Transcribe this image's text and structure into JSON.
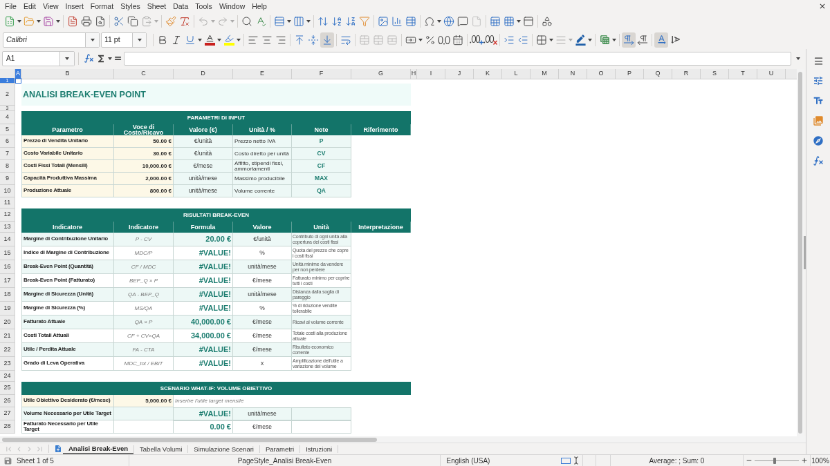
{
  "menu_bar": [
    "File",
    "Edit",
    "View",
    "Insert",
    "Format",
    "Styles",
    "Sheet",
    "Data",
    "Tools",
    "Window",
    "Help"
  ],
  "standard_toolbar": {
    "groups": [
      [
        {
          "kind": "new-spreadsheet",
          "dropdown": true,
          "disabled": false,
          "pressed": false
        },
        {
          "kind": "open",
          "dropdown": true,
          "disabled": false,
          "pressed": false
        },
        {
          "kind": "save",
          "dropdown": true,
          "disabled": false,
          "pressed": false
        }
      ],
      [
        {
          "kind": "export-pdf",
          "dropdown": false,
          "disabled": false,
          "pressed": false
        },
        {
          "kind": "print",
          "dropdown": false,
          "disabled": false,
          "pressed": false
        },
        {
          "kind": "print-preview",
          "dropdown": false,
          "disabled": false,
          "pressed": false
        }
      ],
      [
        {
          "kind": "cut",
          "dropdown": false,
          "disabled": false,
          "pressed": false
        },
        {
          "kind": "copy",
          "dropdown": false,
          "disabled": false,
          "pressed": false
        },
        {
          "kind": "paste",
          "dropdown": true,
          "disabled": true,
          "pressed": false
        }
      ],
      [
        {
          "kind": "clone-formatting",
          "dropdown": false,
          "disabled": false,
          "pressed": false
        },
        {
          "kind": "clear-formatting",
          "dropdown": false,
          "disabled": false,
          "pressed": false
        }
      ],
      [
        {
          "kind": "undo",
          "dropdown": true,
          "disabled": true,
          "pressed": false
        },
        {
          "kind": "redo",
          "dropdown": true,
          "disabled": true,
          "pressed": false
        }
      ],
      [
        {
          "kind": "find-replace",
          "dropdown": false,
          "disabled": false,
          "pressed": false
        },
        {
          "kind": "spelling",
          "dropdown": false,
          "disabled": false,
          "pressed": false
        }
      ],
      [
        {
          "kind": "row",
          "dropdown": true,
          "disabled": false,
          "pressed": false
        },
        {
          "kind": "column",
          "dropdown": true,
          "disabled": false,
          "pressed": false
        }
      ],
      [
        {
          "kind": "sort",
          "dropdown": false,
          "disabled": false,
          "pressed": false
        },
        {
          "kind": "sort-ascending",
          "dropdown": false,
          "disabled": false,
          "pressed": false
        },
        {
          "kind": "sort-descending",
          "dropdown": false,
          "disabled": false,
          "pressed": false
        },
        {
          "kind": "autofilter",
          "dropdown": false,
          "disabled": false,
          "pressed": false
        }
      ],
      [
        {
          "kind": "image",
          "dropdown": false,
          "disabled": false,
          "pressed": false
        },
        {
          "kind": "chart",
          "dropdown": false,
          "disabled": false,
          "pressed": false
        },
        {
          "kind": "pivot-table",
          "dropdown": false,
          "disabled": false,
          "pressed": false
        }
      ],
      [
        {
          "kind": "special-character",
          "dropdown": true,
          "disabled": false,
          "pressed": false
        },
        {
          "kind": "hyperlink",
          "dropdown": false,
          "disabled": false,
          "pressed": false
        },
        {
          "kind": "comment",
          "dropdown": false,
          "disabled": false,
          "pressed": false
        },
        {
          "kind": "header-footer",
          "dropdown": false,
          "disabled": true,
          "pressed": false
        }
      ],
      [
        {
          "kind": "print-area",
          "dropdown": false,
          "disabled": false,
          "pressed": false
        },
        {
          "kind": "freeze",
          "dropdown": true,
          "disabled": false,
          "pressed": false
        },
        {
          "kind": "split-window",
          "dropdown": false,
          "disabled": false,
          "pressed": false
        }
      ],
      [
        {
          "kind": "shapes",
          "dropdown": false,
          "disabled": false,
          "pressed": false
        }
      ]
    ]
  },
  "formatting_toolbar": {
    "font_name": "Calibri",
    "font_size": "11 pt",
    "groups": [
      [
        {
          "kind": "bold",
          "dropdown": false,
          "disabled": false,
          "pressed": false
        },
        {
          "kind": "italic",
          "dropdown": false,
          "disabled": false,
          "pressed": false
        },
        {
          "kind": "underline",
          "dropdown": true,
          "disabled": false,
          "pressed": false
        },
        {
          "kind": "font-color",
          "dropdown": true,
          "disabled": false,
          "pressed": false
        },
        {
          "kind": "highlight",
          "dropdown": true,
          "disabled": false,
          "pressed": false
        }
      ],
      [
        {
          "kind": "align-left",
          "dropdown": false,
          "disabled": false,
          "pressed": false
        },
        {
          "kind": "align-center",
          "dropdown": false,
          "disabled": false,
          "pressed": false
        },
        {
          "kind": "align-right",
          "dropdown": false,
          "disabled": false,
          "pressed": false
        }
      ],
      [
        {
          "kind": "align-top",
          "dropdown": false,
          "disabled": false,
          "pressed": false
        },
        {
          "kind": "align-middle",
          "dropdown": false,
          "disabled": false,
          "pressed": false
        },
        {
          "kind": "align-bottom",
          "dropdown": false,
          "disabled": false,
          "pressed": true
        }
      ],
      [
        {
          "kind": "wrap-text",
          "dropdown": false,
          "disabled": false,
          "pressed": false
        }
      ],
      [
        {
          "kind": "merge-center",
          "dropdown": false,
          "disabled": true,
          "pressed": false
        },
        {
          "kind": "merge",
          "dropdown": false,
          "disabled": true,
          "pressed": false
        },
        {
          "kind": "unmerge",
          "dropdown": false,
          "disabled": true,
          "pressed": false
        }
      ],
      [
        {
          "kind": "currency",
          "dropdown": true,
          "disabled": false,
          "pressed": false
        },
        {
          "kind": "percent",
          "dropdown": false,
          "disabled": false,
          "pressed": false
        },
        {
          "kind": "number",
          "dropdown": false,
          "disabled": false,
          "pressed": false
        },
        {
          "kind": "date",
          "dropdown": false,
          "disabled": false,
          "pressed": false
        }
      ],
      [
        {
          "kind": "add-decimal",
          "dropdown": false,
          "disabled": false,
          "pressed": false
        },
        {
          "kind": "delete-decimal",
          "dropdown": false,
          "disabled": false,
          "pressed": false
        }
      ],
      [
        {
          "kind": "indent-increase",
          "dropdown": false,
          "disabled": false,
          "pressed": false
        },
        {
          "kind": "indent-decrease",
          "dropdown": false,
          "disabled": false,
          "pressed": false
        }
      ],
      [
        {
          "kind": "borders",
          "dropdown": true,
          "disabled": false,
          "pressed": false
        },
        {
          "kind": "border-style",
          "dropdown": true,
          "disabled": true,
          "pressed": false
        },
        {
          "kind": "border-color",
          "dropdown": true,
          "disabled": false,
          "pressed": false
        }
      ],
      [
        {
          "kind": "conditional",
          "dropdown": true,
          "disabled": false,
          "pressed": false
        }
      ],
      [
        {
          "kind": "ltr",
          "dropdown": false,
          "disabled": false,
          "pressed": true
        },
        {
          "kind": "rtl",
          "dropdown": false,
          "disabled": false,
          "pressed": false
        }
      ],
      [
        {
          "kind": "horizontal-text",
          "dropdown": false,
          "disabled": false,
          "pressed": true
        },
        {
          "kind": "vertical-text",
          "dropdown": false,
          "disabled": false,
          "pressed": false
        }
      ]
    ]
  },
  "formula_bar": {
    "name_box": "A1"
  },
  "sheet": {
    "columns": [
      {
        "label": "A",
        "selected": true
      },
      {
        "label": "B",
        "selected": false
      },
      {
        "label": "C",
        "selected": false
      },
      {
        "label": "D",
        "selected": false
      },
      {
        "label": "E",
        "selected": false
      },
      {
        "label": "F",
        "selected": false
      },
      {
        "label": "G",
        "selected": false
      },
      {
        "label": "H",
        "selected": false
      },
      {
        "label": "I",
        "selected": false
      },
      {
        "label": "J",
        "selected": false
      },
      {
        "label": "K",
        "selected": false
      },
      {
        "label": "L",
        "selected": false
      },
      {
        "label": "M",
        "selected": false
      },
      {
        "label": "N",
        "selected": false
      },
      {
        "label": "O",
        "selected": false
      },
      {
        "label": "P",
        "selected": false
      },
      {
        "label": "Q",
        "selected": false
      },
      {
        "label": "R",
        "selected": false
      },
      {
        "label": "S",
        "selected": false
      },
      {
        "label": "T",
        "selected": false
      },
      {
        "label": "U",
        "selected": false
      }
    ],
    "rows": [
      {
        "number": "1",
        "selected": true,
        "kind": "spacer"
      },
      {
        "number": "2",
        "selected": false,
        "kind": "title",
        "cells": [
          "ANALISI BREAK-EVEN POINT"
        ]
      },
      {
        "number": "3",
        "selected": false,
        "kind": "spacer"
      },
      {
        "number": "4",
        "selected": false,
        "kind": "section",
        "cells": [
          "PARAMETRI DI INPUT"
        ]
      },
      {
        "number": "5",
        "selected": false,
        "kind": "header",
        "cells": [
          "Parametro",
          "Voce di Costo/Ricavo",
          "Valore (€)",
          "Unità / %",
          "Note",
          "Riferimento"
        ]
      },
      {
        "number": "6",
        "selected": false,
        "kind": "input",
        "cells": [
          "Prezzo di Vendita Unitario",
          "50.00 €",
          "€/unità",
          "Prezzo netto IVA",
          "P"
        ]
      },
      {
        "number": "7",
        "selected": false,
        "kind": "input",
        "cells": [
          "Costo Variabile Unitario",
          "30.00 €",
          "€/unità",
          "Costo diretto per unità",
          "CV"
        ]
      },
      {
        "number": "8",
        "selected": false,
        "kind": "input",
        "cells": [
          "Costi Fissi Totali (Mensili)",
          "10,000.00 €",
          "€/mese",
          "Affitto, stipendi fissi, ammortamenti",
          "CF"
        ]
      },
      {
        "number": "9",
        "selected": false,
        "kind": "input",
        "cells": [
          "Capacità Produttiva Massima",
          "2,000.00 €",
          "unità/mese",
          "Massimo producibile",
          "MAX"
        ]
      },
      {
        "number": "10",
        "selected": false,
        "kind": "input",
        "cells": [
          "Produzione Attuale",
          "800.00 €",
          "unità/mese",
          "Volume corrente",
          "QA"
        ]
      },
      {
        "number": "11",
        "selected": false,
        "kind": "blank"
      },
      {
        "number": "12",
        "selected": false,
        "kind": "section",
        "cells": [
          "RISULTATI BREAK-EVEN"
        ]
      },
      {
        "number": "13",
        "selected": false,
        "kind": "header",
        "cells": [
          "Indicatore",
          "Indicatore",
          "Formula",
          "Valore",
          "Unità",
          "Interpretazione"
        ]
      },
      {
        "number": "14",
        "selected": false,
        "kind": "result",
        "cells": [
          "Margine di Contribuzione Unitario",
          "P - CV",
          "20.00 €",
          "€/unità",
          "Contributo di ogni unità alla copertura dei costi fissi"
        ]
      },
      {
        "number": "15",
        "selected": false,
        "kind": "result",
        "cells": [
          "Indice di Margine di Contribuzione",
          "MDC/P",
          "#VALUE!",
          "%",
          "Quota del prezzo che copre i costi fissi"
        ]
      },
      {
        "number": "16",
        "selected": false,
        "kind": "result",
        "cells": [
          "Break-Even Point (Quantità)",
          "CF / MDC",
          "#VALUE!",
          "unità/mese",
          "Unità minime da vendere per non perdere"
        ]
      },
      {
        "number": "17",
        "selected": false,
        "kind": "result",
        "cells": [
          "Break-Even Point (Fatturato)",
          "BEP_Q × P",
          "#VALUE!",
          "€/mese",
          "Fatturato minimo per coprire tutti i costi"
        ]
      },
      {
        "number": "18",
        "selected": false,
        "kind": "result",
        "cells": [
          "Margine di Sicurezza (Unità)",
          "QA - BEP_Q",
          "#VALUE!",
          "unità/mese",
          "Distanza dalla soglia di pareggio"
        ]
      },
      {
        "number": "19",
        "selected": false,
        "kind": "result",
        "cells": [
          "Margine di Sicurezza (%)",
          "MS/QA",
          "#VALUE!",
          "%",
          "% di riduzione vendite tollerabile"
        ]
      },
      {
        "number": "20",
        "selected": false,
        "kind": "result",
        "cells": [
          "Fatturato Attuale",
          "QA × P",
          "40,000.00 €",
          "€/mese",
          "Ricavi al volume corrente"
        ]
      },
      {
        "number": "21",
        "selected": false,
        "kind": "result",
        "cells": [
          "Costi Totali Attuali",
          "CF + CV×QA",
          "34,000.00 €",
          "€/mese",
          "Totale costi alla produzione attuale"
        ]
      },
      {
        "number": "22",
        "selected": false,
        "kind": "result",
        "cells": [
          "Utile / Perdita Attuale",
          "FA - CTA",
          "#VALUE!",
          "€/mese",
          "Risultato economico corrente"
        ]
      },
      {
        "number": "23",
        "selected": false,
        "kind": "result",
        "cells": [
          "Grado di Leva Operativa",
          "MDC_tot / EBIT",
          "#VALUE!",
          "x",
          "Amplificazione dell'utile a variazione del volume"
        ]
      },
      {
        "number": "24",
        "selected": false,
        "kind": "blank"
      },
      {
        "number": "25",
        "selected": false,
        "kind": "section",
        "cells": [
          "SCENARIO WHAT-IF: VOLUME OBIETTIVO"
        ]
      },
      {
        "number": "26",
        "selected": false,
        "kind": "whatif-input",
        "cells": [
          "Utile Obiettivo Desiderato (€/mese)",
          "5,000.00 €",
          "Inserire l'utile target mensile"
        ]
      },
      {
        "number": "27",
        "selected": false,
        "kind": "target",
        "cells": [
          "Volume Necessario per Utile Target",
          "#VALUE!",
          "unità/mese"
        ]
      },
      {
        "number": "28",
        "selected": false,
        "kind": "target",
        "cells": [
          "Fatturato Necessario per Utile Target",
          "0.00 €",
          "€/mese"
        ]
      }
    ]
  },
  "sheet_tabs": {
    "navigation": [
      {
        "kind": "first",
        "disabled": true
      },
      {
        "kind": "previous",
        "disabled": true
      },
      {
        "kind": "next",
        "disabled": true
      },
      {
        "kind": "last",
        "disabled": true
      }
    ],
    "tabs": [
      {
        "label": "Analisi Break-Even",
        "selected": true
      },
      {
        "label": "Tabella Volumi",
        "selected": false
      },
      {
        "label": "Simulazione Scenari",
        "selected": false
      },
      {
        "label": "Parametri",
        "selected": false
      },
      {
        "label": "Istruzioni",
        "selected": false
      }
    ]
  },
  "status_bar": {
    "sheet": "Sheet 1 of 5",
    "page_style": "PageStyle_Analisi Break-Even",
    "language": "English (USA)",
    "summary": "Average: ; Sum: 0",
    "zoom": {
      "level": 0.45
    },
    "zoom_percent": "100%"
  }
}
